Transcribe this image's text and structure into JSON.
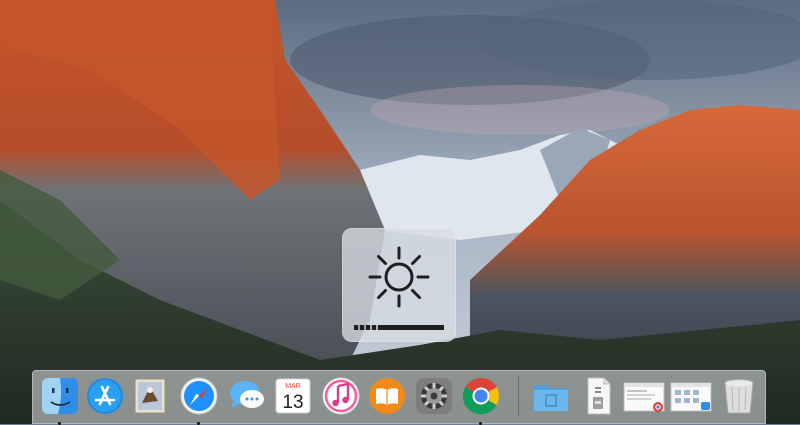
{
  "desktop": {
    "wallpaper": "el-capitan-mountain-landscape"
  },
  "brightness_hud": {
    "icon": "brightness-sun-icon",
    "level_fraction": 0.3
  },
  "dock": {
    "apps": [
      {
        "id": "finder",
        "icon": "finder-icon",
        "running": true
      },
      {
        "id": "app-store",
        "icon": "app-store-icon",
        "running": false
      },
      {
        "id": "mail",
        "icon": "mail-icon",
        "running": false
      },
      {
        "id": "safari",
        "icon": "safari-icon",
        "running": true
      },
      {
        "id": "messages",
        "icon": "messages-icon",
        "running": false
      },
      {
        "id": "calendar",
        "icon": "calendar-icon",
        "running": false
      },
      {
        "id": "itunes",
        "icon": "itunes-icon",
        "running": false
      },
      {
        "id": "ibooks",
        "icon": "ibooks-icon",
        "running": false
      },
      {
        "id": "system-preferences",
        "icon": "gear-icon",
        "running": false
      },
      {
        "id": "chrome",
        "icon": "chrome-icon",
        "running": true
      }
    ],
    "calendar": {
      "month": "MAR",
      "day": "13"
    },
    "right_items": [
      {
        "id": "applications-folder",
        "icon": "folder-icon"
      },
      {
        "id": "archive-document",
        "icon": "document-icon"
      },
      {
        "id": "chrome-window-minimized",
        "icon": "window-thumbnail-icon"
      },
      {
        "id": "finder-window-minimized",
        "icon": "window-thumbnail-icon"
      },
      {
        "id": "trash",
        "icon": "trash-icon"
      }
    ]
  },
  "colors": {
    "finder_blue": "#2f8ee8",
    "chrome_red": "#db4437",
    "chrome_yellow": "#f4c20d",
    "chrome_green": "#0f9d58",
    "chrome_blue": "#4285f4",
    "ibooks_orange": "#f28a1a",
    "folder_blue": "#6bb7ec"
  }
}
